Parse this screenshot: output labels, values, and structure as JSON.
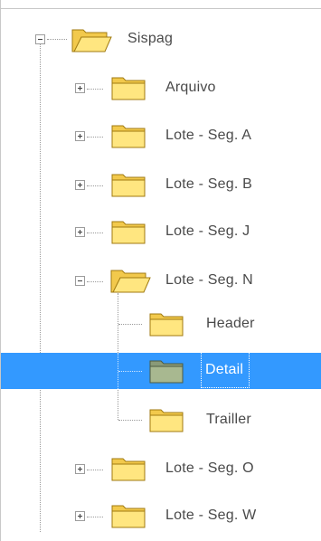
{
  "tree": {
    "root": {
      "label": "Sispag",
      "expanded": true
    },
    "children": [
      {
        "label": "Arquivo",
        "expanded": false
      },
      {
        "label": "Lote - Seg. A",
        "expanded": false
      },
      {
        "label": "Lote - Seg. B",
        "expanded": false
      },
      {
        "label": "Lote - Seg. J",
        "expanded": false
      },
      {
        "label": "Lote - Seg. N",
        "expanded": true,
        "children": [
          {
            "label": "Header"
          },
          {
            "label": "Detail",
            "selected": true
          },
          {
            "label": "Trailler"
          }
        ]
      },
      {
        "label": "Lote - Seg. O",
        "expanded": false
      },
      {
        "label": "Lote - Seg. W",
        "expanded": false
      }
    ]
  },
  "colors": {
    "selection": "#3399ff",
    "folder_fill": "#ffe680",
    "folder_selected_fill": "#a8b890",
    "text": "#4a4a4a"
  }
}
